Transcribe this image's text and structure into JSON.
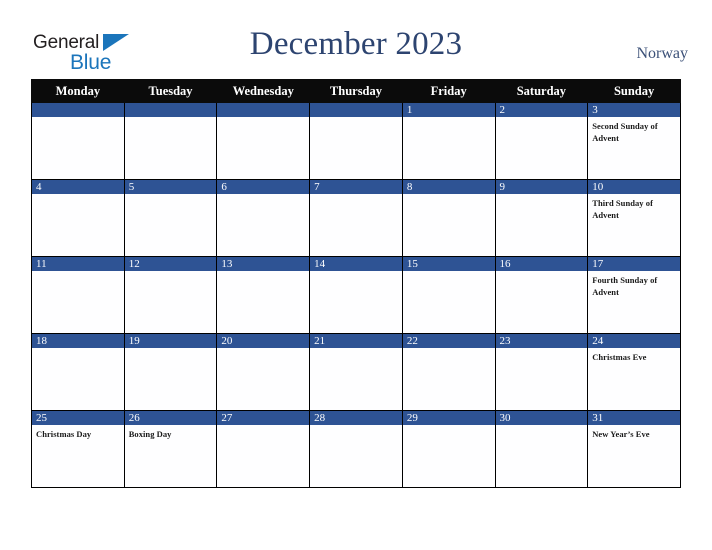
{
  "brand": {
    "name_part1": "General",
    "name_part2": "Blue",
    "triangle_color": "#1b75bb",
    "text_color": "#231f20"
  },
  "header": {
    "title": "December 2023",
    "country": "Norway",
    "title_color": "#2d4470"
  },
  "calendar": {
    "accent_color": "#2e5394",
    "header_bg": "#0b0b0b",
    "weekday_headers": [
      "Monday",
      "Tuesday",
      "Wednesday",
      "Thursday",
      "Friday",
      "Saturday",
      "Sunday"
    ],
    "weeks": [
      [
        {
          "date": "",
          "events": []
        },
        {
          "date": "",
          "events": []
        },
        {
          "date": "",
          "events": []
        },
        {
          "date": "",
          "events": []
        },
        {
          "date": "1",
          "events": []
        },
        {
          "date": "2",
          "events": []
        },
        {
          "date": "3",
          "events": [
            "Second Sunday of Advent"
          ]
        }
      ],
      [
        {
          "date": "4",
          "events": []
        },
        {
          "date": "5",
          "events": []
        },
        {
          "date": "6",
          "events": []
        },
        {
          "date": "7",
          "events": []
        },
        {
          "date": "8",
          "events": []
        },
        {
          "date": "9",
          "events": []
        },
        {
          "date": "10",
          "events": [
            "Third Sunday of Advent"
          ]
        }
      ],
      [
        {
          "date": "11",
          "events": []
        },
        {
          "date": "12",
          "events": []
        },
        {
          "date": "13",
          "events": []
        },
        {
          "date": "14",
          "events": []
        },
        {
          "date": "15",
          "events": []
        },
        {
          "date": "16",
          "events": []
        },
        {
          "date": "17",
          "events": [
            "Fourth Sunday of Advent"
          ]
        }
      ],
      [
        {
          "date": "18",
          "events": []
        },
        {
          "date": "19",
          "events": []
        },
        {
          "date": "20",
          "events": []
        },
        {
          "date": "21",
          "events": []
        },
        {
          "date": "22",
          "events": []
        },
        {
          "date": "23",
          "events": []
        },
        {
          "date": "24",
          "events": [
            "Christmas Eve"
          ]
        }
      ],
      [
        {
          "date": "25",
          "events": [
            "Christmas Day"
          ]
        },
        {
          "date": "26",
          "events": [
            "Boxing Day"
          ]
        },
        {
          "date": "27",
          "events": []
        },
        {
          "date": "28",
          "events": []
        },
        {
          "date": "29",
          "events": []
        },
        {
          "date": "30",
          "events": []
        },
        {
          "date": "31",
          "events": [
            "New Year’s Eve"
          ]
        }
      ]
    ]
  }
}
